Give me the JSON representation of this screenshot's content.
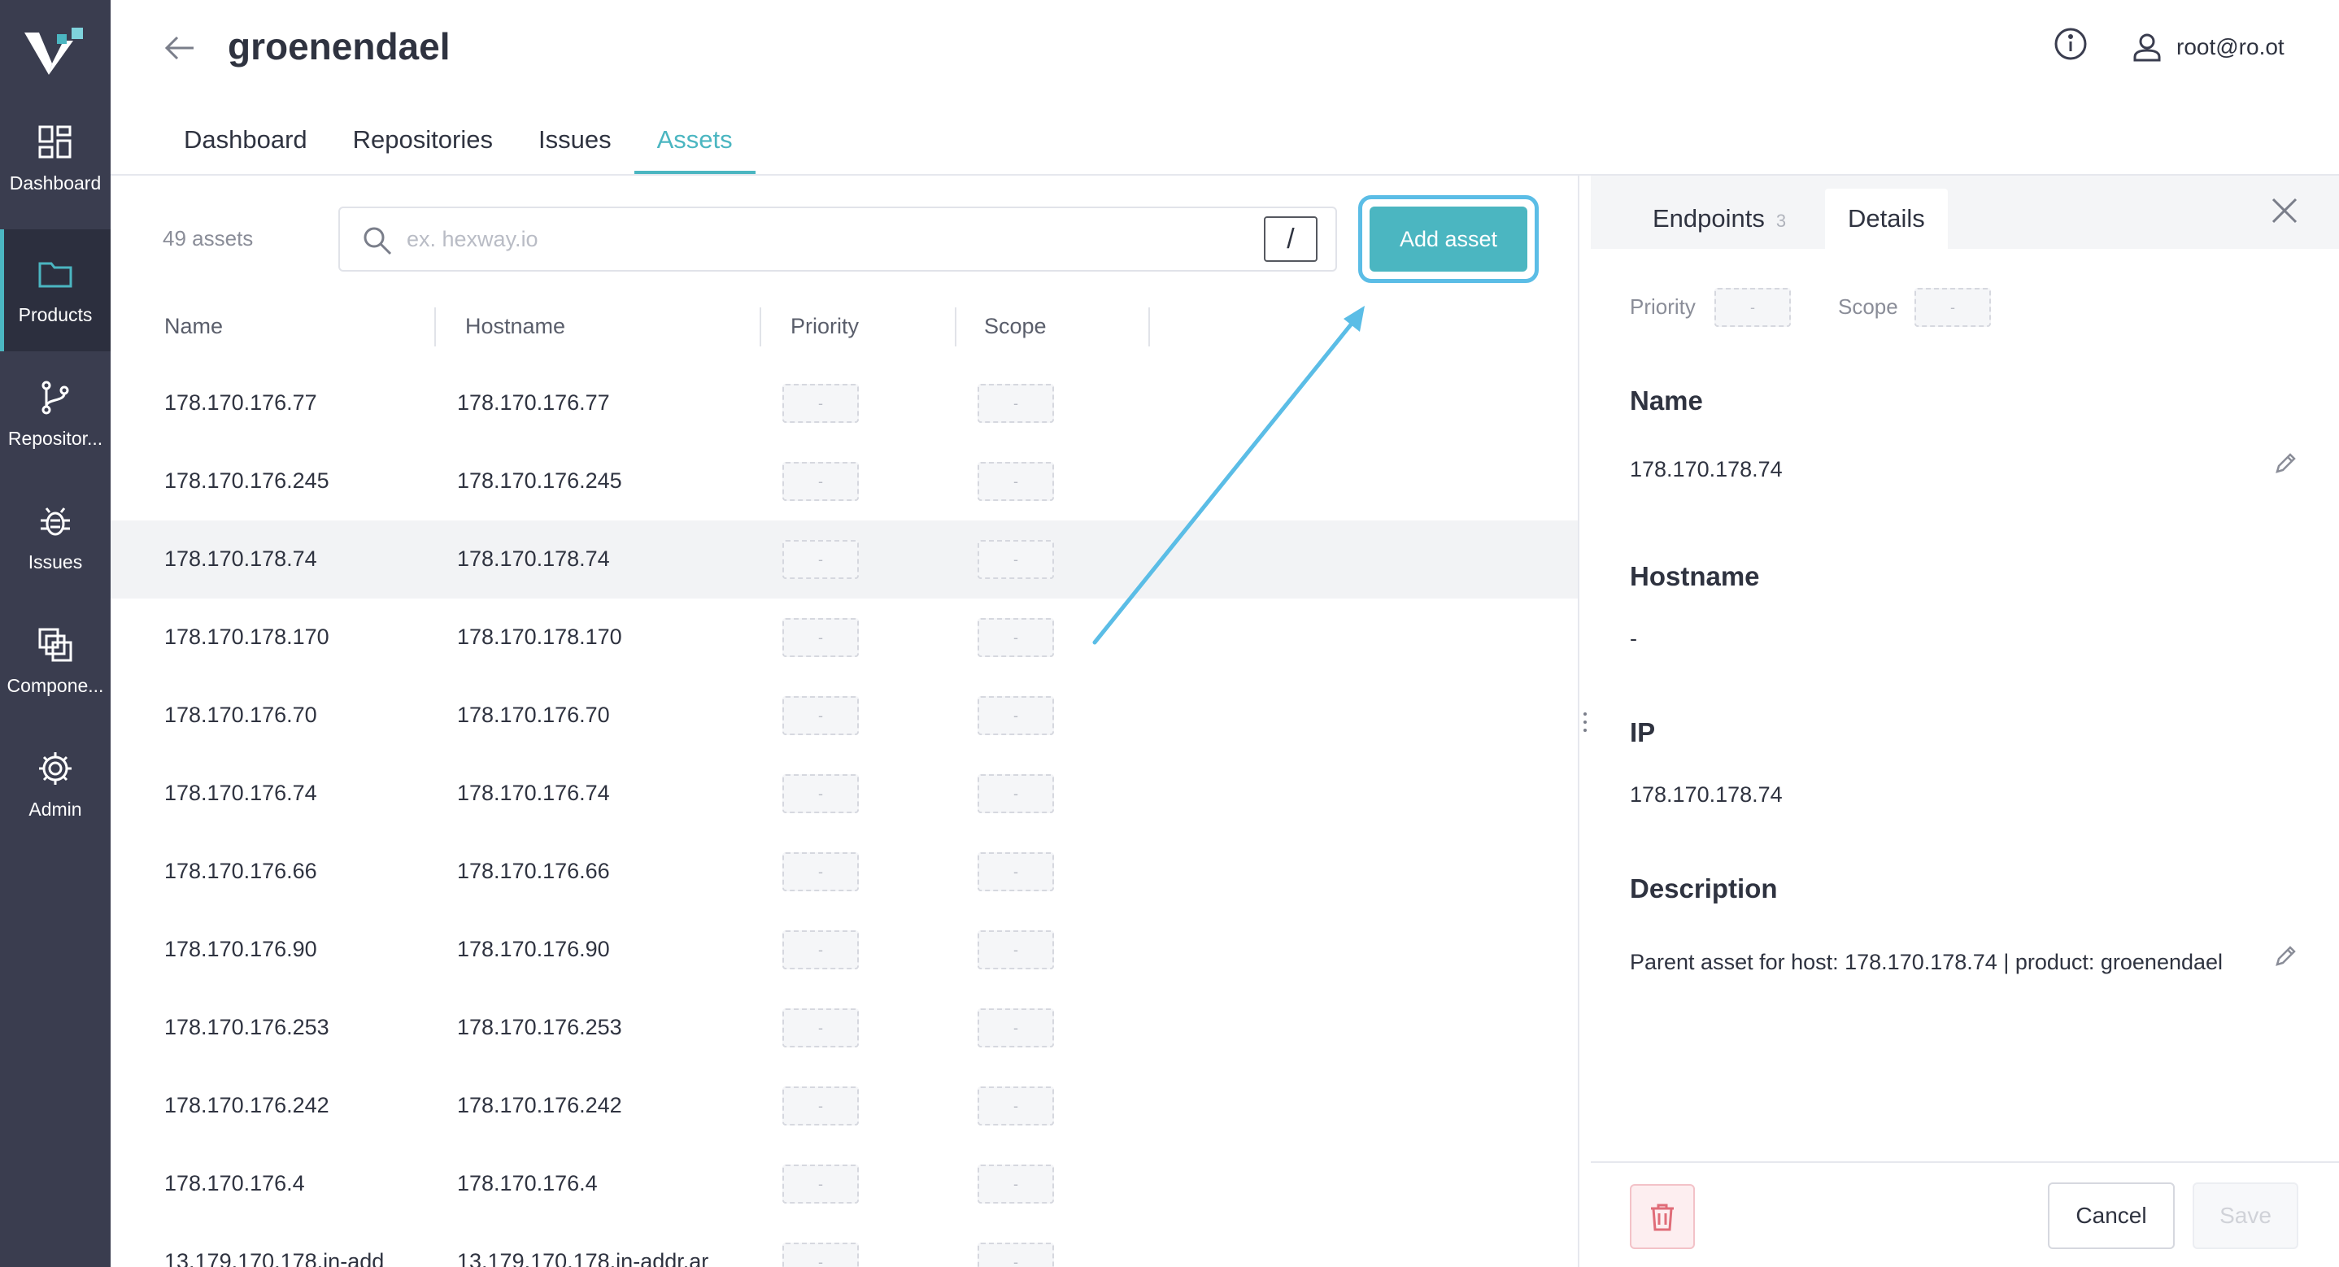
{
  "sidebar": {
    "items": [
      {
        "label": "Dashboard",
        "icon": "dashboard-icon"
      },
      {
        "label": "Products",
        "icon": "folder-icon"
      },
      {
        "label": "Repositor...",
        "icon": "branch-icon"
      },
      {
        "label": "Issues",
        "icon": "bug-icon"
      },
      {
        "label": "Compone...",
        "icon": "components-icon"
      },
      {
        "label": "Admin",
        "icon": "gear-icon"
      }
    ],
    "active": "Products"
  },
  "header": {
    "title": "groenendael",
    "user": "root@ro.ot",
    "tabs": [
      "Dashboard",
      "Repositories",
      "Issues",
      "Assets"
    ],
    "active_tab": "Assets"
  },
  "assets": {
    "count_label": "49 assets",
    "search": {
      "placeholder": "ex. hexway.io",
      "value": "",
      "shortcut": "/"
    },
    "add_button": "Add asset",
    "columns": [
      "Name",
      "Hostname",
      "Priority",
      "Scope"
    ],
    "rows": [
      {
        "name": "178.170.176.77",
        "hostname": "178.170.176.77",
        "priority": "-",
        "scope": "-"
      },
      {
        "name": "178.170.176.245",
        "hostname": "178.170.176.245",
        "priority": "-",
        "scope": "-"
      },
      {
        "name": "178.170.178.74",
        "hostname": "178.170.178.74",
        "priority": "-",
        "scope": "-"
      },
      {
        "name": "178.170.178.170",
        "hostname": "178.170.178.170",
        "priority": "-",
        "scope": "-"
      },
      {
        "name": "178.170.176.70",
        "hostname": "178.170.176.70",
        "priority": "-",
        "scope": "-"
      },
      {
        "name": "178.170.176.74",
        "hostname": "178.170.176.74",
        "priority": "-",
        "scope": "-"
      },
      {
        "name": "178.170.176.66",
        "hostname": "178.170.176.66",
        "priority": "-",
        "scope": "-"
      },
      {
        "name": "178.170.176.90",
        "hostname": "178.170.176.90",
        "priority": "-",
        "scope": "-"
      },
      {
        "name": "178.170.176.253",
        "hostname": "178.170.176.253",
        "priority": "-",
        "scope": "-"
      },
      {
        "name": "178.170.176.242",
        "hostname": "178.170.176.242",
        "priority": "-",
        "scope": "-"
      },
      {
        "name": "178.170.176.4",
        "hostname": "178.170.176.4",
        "priority": "-",
        "scope": "-"
      },
      {
        "name": "13.179.170.178.in-add",
        "hostname": "13.179.170.178.in-addr.ar",
        "priority": "-",
        "scope": "-"
      }
    ],
    "selected_index": 2
  },
  "details": {
    "tabs": [
      {
        "label": "Endpoints",
        "count": "3"
      },
      {
        "label": "Details",
        "count": ""
      }
    ],
    "active_tab": "Details",
    "priority_label": "Priority",
    "priority_value": "-",
    "scope_label": "Scope",
    "scope_value": "-",
    "name_title": "Name",
    "name_value": "178.170.178.74",
    "hostname_title": "Hostname",
    "hostname_value": "-",
    "ip_title": "IP",
    "ip_value": "178.170.178.74",
    "description_title": "Description",
    "description_value": "Parent asset for host: 178.170.178.74 | product: groenendael",
    "cancel_label": "Cancel",
    "save_label": "Save"
  },
  "colors": {
    "accent": "#4bb6c1",
    "sidebar": "#3a3d4f",
    "highlight_ring": "#5bbde6",
    "danger": "#e06c78"
  }
}
